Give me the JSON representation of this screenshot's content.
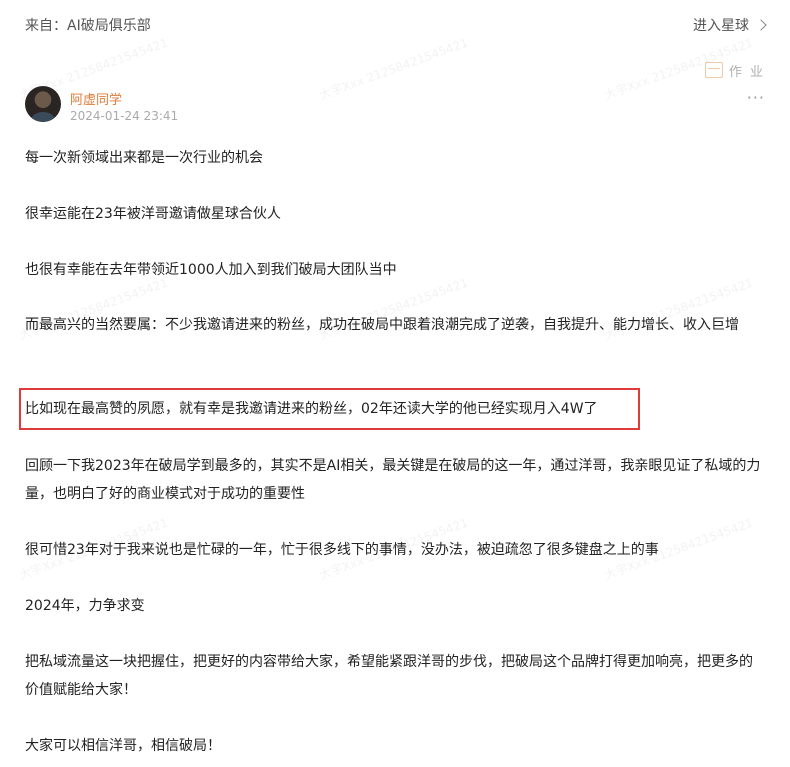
{
  "header": {
    "source": "来自：AI破局俱乐部",
    "enter_link": "进入星球"
  },
  "badge": {
    "label": "作 业"
  },
  "post": {
    "author": "阿虚同学",
    "time": "2024-01-24 23:41",
    "more": "···",
    "paragraphs": [
      "每一次新领域出来都是一次行业的机会",
      "很幸运能在23年被洋哥邀请做星球合伙人",
      "也很有幸能在去年带领近1000人加入到我们破局大团队当中",
      "而最高兴的当然要属：不少我邀请进来的粉丝，成功在破局中跟着浪潮完成了逆袭，自我提升、能力增长、收入巨增",
      "比如现在最高赞的夙愿，就有幸是我邀请进来的粉丝，02年还读大学的他已经实现月入4W了",
      "回顾一下我2023年在破局学到最多的，其实不是AI相关，最关键是在破局的这一年，通过洋哥，我亲眼见证了私域的力量，也明白了好的商业模式对于成功的重要性",
      "很可惜23年对于我来说也是忙碌的一年，忙于很多线下的事情，没办法，被迫疏忽了很多键盘之上的事",
      "2024年，力争求变",
      "把私域流量这一块把握住，把更好的内容带给大家，希望能紧跟洋哥的步伐，把破局这个品牌打得更加响亮，把更多的价值赋能给大家！",
      "大家可以相信洋哥，相信破局！"
    ]
  },
  "watermark": "大宇Xxx 21258421545421",
  "colors": {
    "author": "#e07b39",
    "highlight_border": "#e03a3a"
  }
}
